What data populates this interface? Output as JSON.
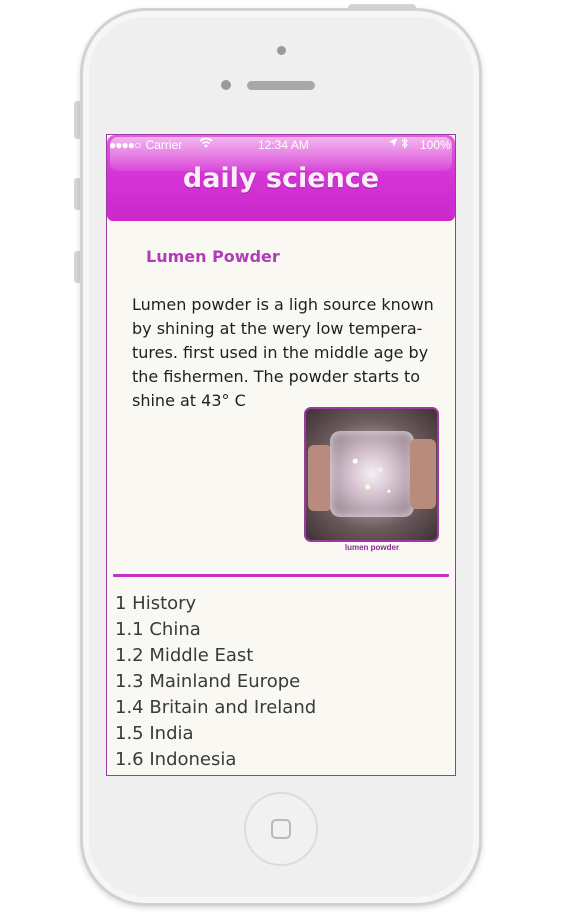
{
  "status_bar": {
    "signal_dots": "●●●●○",
    "carrier": "Carrier",
    "time": "12:34 AM",
    "battery": "100%",
    "icons": [
      "wifi-icon",
      "location-arrow-icon",
      "bluetooth-icon"
    ]
  },
  "header": {
    "title": "daily science"
  },
  "article": {
    "title": "Lumen Powder",
    "body": "Lumen powder is a ligh source known by shining at the wery low tempera- tures. first used in the middle age by the fishermen. The powder starts to shine at 43° C",
    "image_caption": "lumen powder"
  },
  "toc": [
    " 1 History",
    "1.1 China",
    "1.2 Middle East",
    "1.3 Mainland Europe",
    "1.4 Britain and Ireland",
    "1.5 India",
    "1.6 Indonesia"
  ],
  "colors": {
    "accent": "#cc28cc",
    "title_text": "#b23bba",
    "screen_bg": "#f9f8f3"
  }
}
